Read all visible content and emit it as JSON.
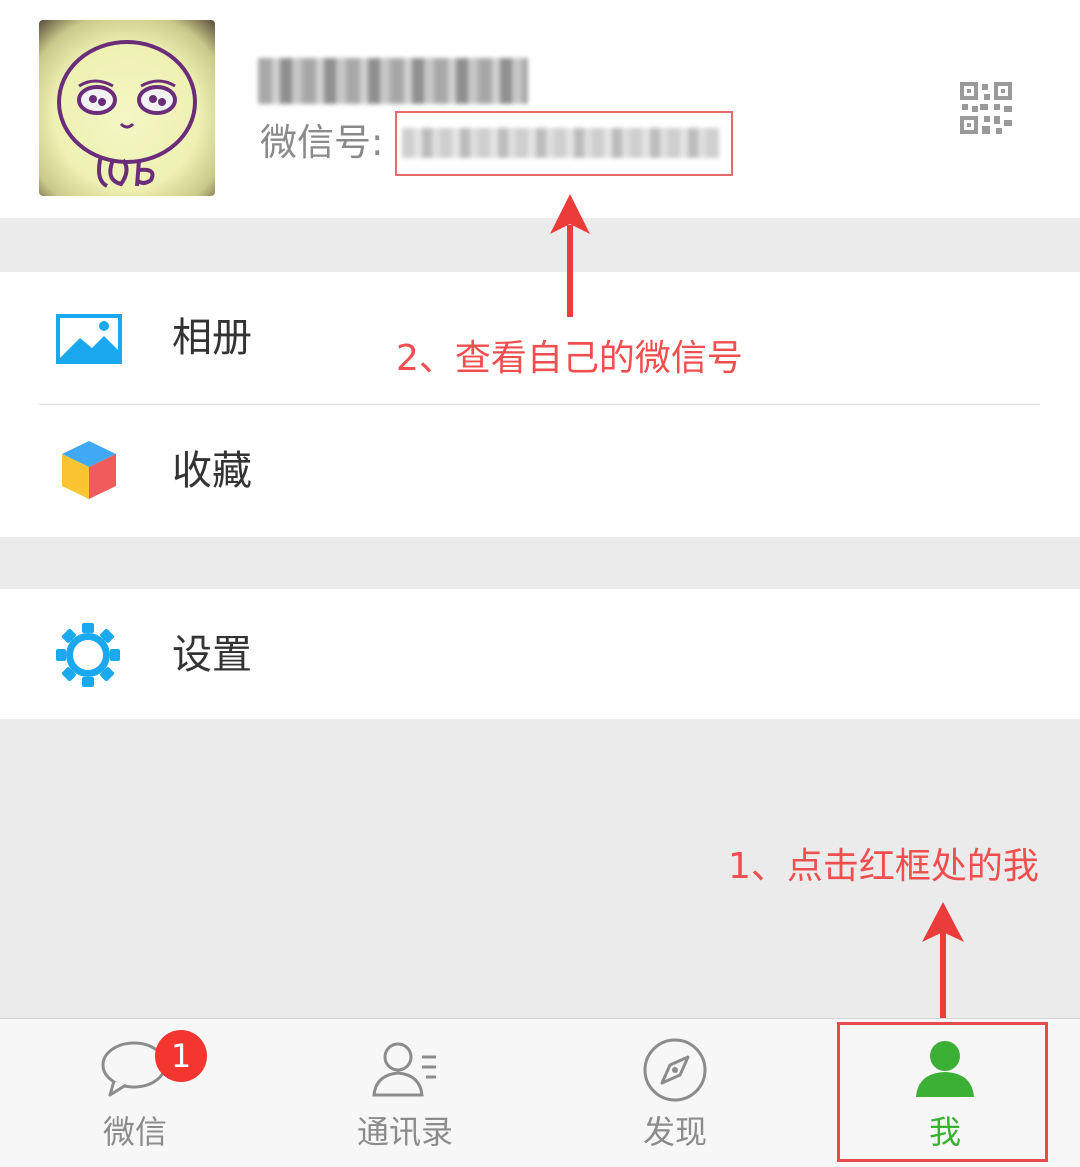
{
  "profile": {
    "wechat_id_label": "微信号:"
  },
  "menu": {
    "album": "相册",
    "favorites": "收藏",
    "settings": "设置"
  },
  "annotations": {
    "step2": "2、查看自己的微信号",
    "step1": "1、点击红框处的我"
  },
  "tabs": [
    {
      "label": "微信",
      "icon": "chat-bubble-icon",
      "badge": "1"
    },
    {
      "label": "通讯录",
      "icon": "contacts-icon"
    },
    {
      "label": "发现",
      "icon": "compass-icon"
    },
    {
      "label": "我",
      "icon": "person-icon",
      "active": true
    }
  ],
  "colors": {
    "accent_green": "#3cb034",
    "annotation_red": "#ef4f4f",
    "icon_blue": "#1aa8ef"
  }
}
